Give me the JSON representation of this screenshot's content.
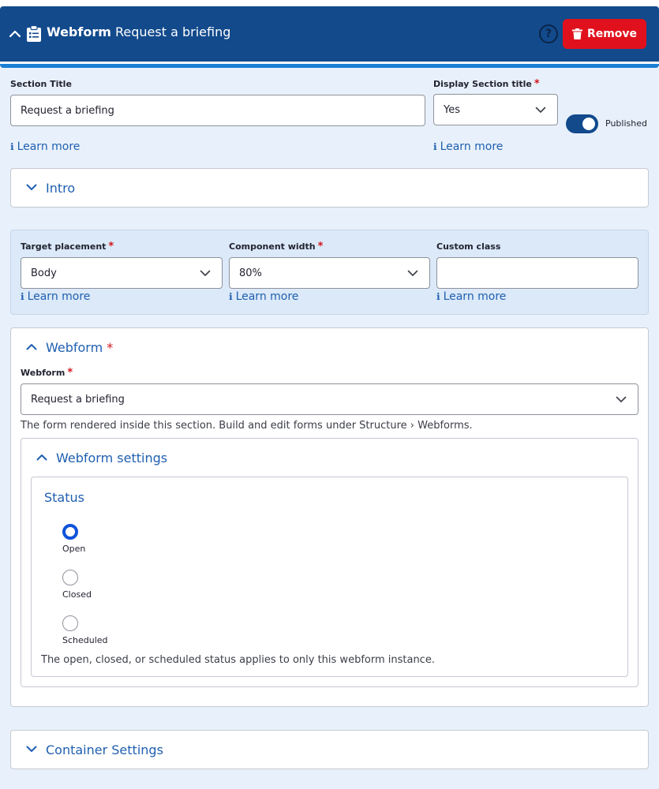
{
  "header": {
    "type_label": "Webform",
    "instance_title": "Request a briefing",
    "help_glyph": "?",
    "remove_label": "Remove",
    "bg_color": "#124a8c",
    "remove_color": "#e0111d"
  },
  "section_title": {
    "label": "Section Title",
    "value": "Request a briefing",
    "learn_more": "Learn more"
  },
  "display_section_title": {
    "label": "Display Section title",
    "required_mark": "*",
    "value": "Yes",
    "learn_more": "Learn more"
  },
  "published_toggle": {
    "label": "Published",
    "on": true
  },
  "intro": {
    "label": "Intro",
    "expanded": false
  },
  "placement": {
    "target_placement": {
      "label": "Target placement",
      "required_mark": "*",
      "value": "Body",
      "learn_more": "Learn more"
    },
    "component_width": {
      "label": "Component width",
      "required_mark": "*",
      "value": "80%",
      "learn_more": "Learn more"
    },
    "custom_class": {
      "label": "Custom class",
      "value": "",
      "learn_more": "Learn more"
    }
  },
  "webform_section": {
    "title": "Webform",
    "required_mark": "*",
    "field_label": "Webform",
    "field_value": "Request a briefing",
    "description": "The form rendered inside this section. Build and edit forms under Structure › Webforms.",
    "settings": {
      "title": "Webform settings",
      "status_title": "Status",
      "options": [
        {
          "label": "Open",
          "checked": true
        },
        {
          "label": "Closed",
          "checked": false
        },
        {
          "label": "Scheduled",
          "checked": false
        }
      ],
      "status_help": "The open, closed, or scheduled status applies to only this webform instance."
    }
  },
  "container_settings": {
    "label": "Container Settings",
    "expanded": false
  },
  "icons": {
    "info": "ℹ",
    "collapse": "chevron-up-icon",
    "expand": "chevron-down-icon"
  }
}
